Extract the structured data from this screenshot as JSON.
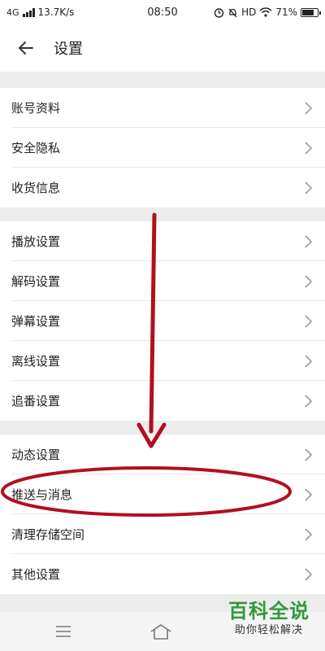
{
  "status_bar": {
    "network": "4G",
    "speed": "13.7K/s",
    "time": "08:50",
    "hd_label": "HD",
    "battery": "71%"
  },
  "header": {
    "title": "设置"
  },
  "groups": [
    {
      "items": [
        {
          "label": "账号资料"
        },
        {
          "label": "安全隐私"
        },
        {
          "label": "收货信息"
        }
      ]
    },
    {
      "items": [
        {
          "label": "播放设置"
        },
        {
          "label": "解码设置"
        },
        {
          "label": "弹幕设置"
        },
        {
          "label": "离线设置"
        },
        {
          "label": "追番设置"
        }
      ]
    },
    {
      "items": [
        {
          "label": "动态设置"
        },
        {
          "label": "推送与消息"
        },
        {
          "label": "清理存储空间"
        },
        {
          "label": "其他设置"
        }
      ]
    }
  ],
  "icons": {
    "back": "arrow-left-icon",
    "chevron": "chevron-right-icon",
    "nav_menu": "menu-icon",
    "nav_home": "home-icon"
  },
  "watermark": {
    "title": "百科全说",
    "subtitle": "助你轻松解决"
  },
  "colors": {
    "annotation": "#b01020",
    "watermark_green": "#2e9a3c"
  }
}
